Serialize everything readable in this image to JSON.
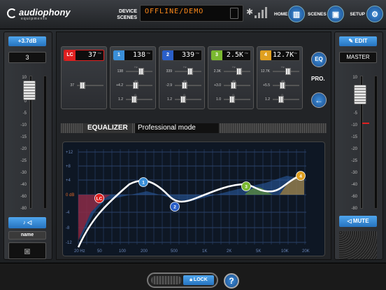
{
  "brand": {
    "name": "audiophony",
    "tagline": "equipments"
  },
  "topbar": {
    "device_scenes_line1": "DEVICE",
    "device_scenes_line2": "SCENES",
    "lcd_text": "OFFLINE/DEMO",
    "home_label": "HOME",
    "scenes_label": "SCENES",
    "setup_label": "SETUP",
    "bluetooth_icon": "bluetooth-icon",
    "signal_icon": "signal-icon"
  },
  "left": {
    "gain_label": "+3.7dB",
    "channel_number": "3",
    "scale": [
      "10",
      "5",
      "0",
      "-5",
      "-10",
      "-15",
      "-20",
      "-25",
      "-30",
      "-40",
      "-60",
      "-80"
    ],
    "name_label": "name",
    "fader_level_db": 3.7
  },
  "right": {
    "edit_label": "EDIT",
    "channel_name": "MASTER",
    "scale": [
      "10",
      "5",
      "0",
      "-5",
      "-10",
      "-15",
      "-20",
      "-25",
      "-30",
      "-40",
      "-60",
      "-80"
    ],
    "mute_label": "MUTE",
    "fader_level_db": 2
  },
  "bands": [
    {
      "label": "LC",
      "freq": "37",
      "color": "#e02020",
      "freq_val": "37",
      "q_val": "",
      "gain_val": ""
    },
    {
      "label": "1",
      "freq": "138",
      "color": "#3a8fd8",
      "freq_val": "138",
      "gain_val": "+4.2",
      "q_val": "1.2"
    },
    {
      "label": "2",
      "freq": "339",
      "color": "#2a5fc8",
      "freq_val": "339",
      "gain_val": "-2.9",
      "q_val": "1.2"
    },
    {
      "label": "3",
      "freq": "2.5K",
      "color": "#7ab830",
      "freq_val": "2.3K",
      "gain_val": "+3.0",
      "q_val": "1.0"
    },
    {
      "label": "4",
      "freq": "12.7K",
      "color": "#e0a020",
      "freq_val": "12.7K",
      "gain_val": "+5.5",
      "q_val": "1.2"
    }
  ],
  "band_units": {
    "hz": "Hz",
    "db": "dB",
    "q": "Q"
  },
  "side_buttons": {
    "eq": "EQ",
    "pro": "PRO."
  },
  "equalizer": {
    "title": "EQUALIZER",
    "mode": "Professional mode",
    "y_ticks": [
      "+12",
      "+8",
      "+4",
      "0 dB",
      "-4",
      "-8",
      "-12"
    ],
    "x_ticks": [
      "20 Hz",
      "50",
      "100",
      "200",
      "500",
      "1K",
      "2K",
      "5K",
      "10K",
      "20K"
    ],
    "nodes": [
      {
        "label": "LC",
        "color": "#e02020"
      },
      {
        "label": "1",
        "color": "#3a8fd8"
      },
      {
        "label": "2",
        "color": "#2a5fc8"
      },
      {
        "label": "3",
        "color": "#7ab830"
      },
      {
        "label": "4",
        "color": "#e0a020"
      }
    ]
  },
  "bottom": {
    "lock_label": "LOCK",
    "help_label": "?"
  }
}
